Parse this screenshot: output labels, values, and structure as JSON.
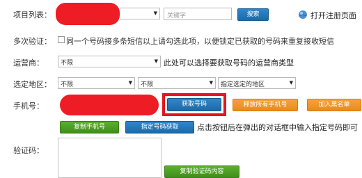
{
  "row_project": {
    "label": "项目列表：",
    "keyword_placeholder": "关键字",
    "search_button": "搜索",
    "open_page_link": "打开注册页面"
  },
  "row_multi": {
    "label": "多次验证：",
    "checkbox_text": "同一个号码接多条短信以上请勾选此项，以便锁定已获取的号码来重复接收短信"
  },
  "row_carrier": {
    "label": "运营商：",
    "selected": "不限",
    "hint": "此处可以选择要获取号码的运营商类型"
  },
  "row_region": {
    "label": "选定地区：",
    "province": "不限",
    "city": "不限",
    "specified": "指定选定的地区"
  },
  "row_phone": {
    "label": "手机号：",
    "get_number_button": "获取号码",
    "release_all_button": "释放所有手机号",
    "blacklist_button": "加入黑名单",
    "copy_phone_button": "复制手机号",
    "specify_button": "指定号码获取",
    "specify_hint": "点击按钮后在弹出的对话框中输入指定号码即可"
  },
  "row_code": {
    "label": "验证码：",
    "copy_code_button": "复制验证码内容"
  },
  "colors": {
    "highlight_border": "#e8141c",
    "redaction": "#ee1c24",
    "blue_button": "#2f86cc",
    "green_button": "#4fa224",
    "orange_button": "#f19628"
  }
}
